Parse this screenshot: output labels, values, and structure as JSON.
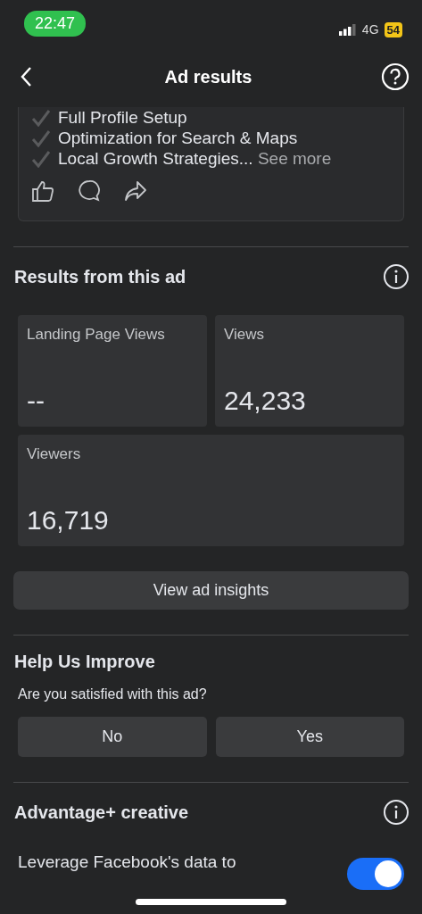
{
  "status_bar": {
    "time": "22:47",
    "network": "4G",
    "battery": "54"
  },
  "header": {
    "title": "Ad results"
  },
  "ad_preview": {
    "checklist": [
      "Full Profile Setup",
      "Optimization for Search & Maps",
      "Local Growth Strategies..."
    ],
    "see_more": "See more"
  },
  "results": {
    "title": "Results from this ad",
    "metrics": [
      {
        "label": "Landing Page Views",
        "value": "--"
      },
      {
        "label": "Views",
        "value": "24,233"
      },
      {
        "label": "Viewers",
        "value": "16,719"
      }
    ],
    "insights_button": "View ad insights"
  },
  "feedback": {
    "title": "Help Us Improve",
    "question": "Are you satisfied with this ad?",
    "buttons": [
      "No",
      "Yes"
    ]
  },
  "advantage": {
    "title": "Advantage+ creative",
    "description": "Leverage Facebook's data to",
    "on": true
  }
}
